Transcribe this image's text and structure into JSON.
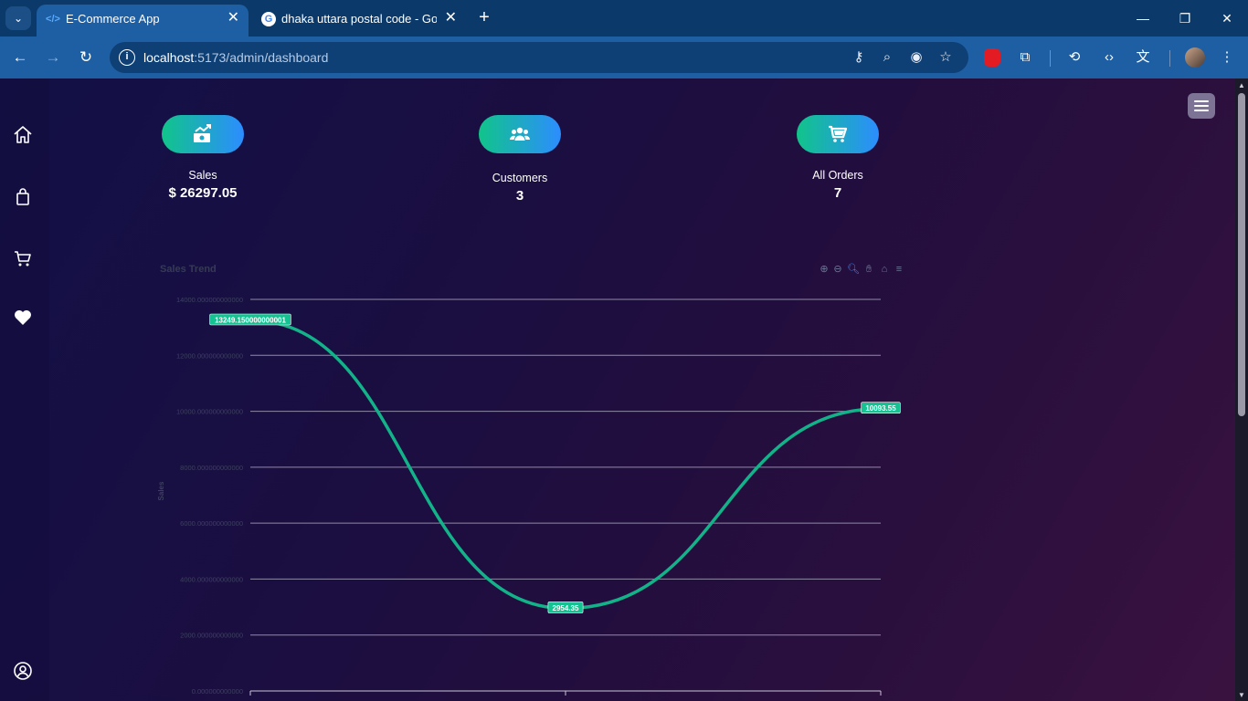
{
  "browser": {
    "tabs": [
      {
        "title": "E-Commerce App",
        "active": true
      },
      {
        "title": "dhaka uttara postal code - Google Search",
        "active": false
      }
    ],
    "url_host": "localhost",
    "url_path": ":5173/admin/dashboard"
  },
  "sidebar": {
    "items": [
      "home-icon",
      "shopping-bag-icon",
      "cart-icon",
      "heart-icon",
      "user-circle-icon"
    ]
  },
  "stats": [
    {
      "label": "Sales",
      "value": "$ 26297.05",
      "icon": "money-trend-icon"
    },
    {
      "label": "Customers",
      "value": "3",
      "icon": "users-icon"
    },
    {
      "label": "All Orders",
      "value": "7",
      "icon": "cart-icon"
    }
  ],
  "colors": {
    "accent_green": "#11c48a",
    "accent_blue": "#2c8dff",
    "line": "#13b38a"
  },
  "chart_data": {
    "type": "line",
    "title": "Sales Trend",
    "ylabel": "Sales",
    "ylim": [
      0,
      14000
    ],
    "yticks": [
      0,
      2000,
      4000,
      6000,
      8000,
      10000,
      12000,
      14000
    ],
    "ytick_labels": [
      "0.000000000000",
      "2000.000000000000",
      "4000.000000000000",
      "6000.000000000000",
      "8000.000000000000",
      "10000.000000000000",
      "12000.000000000000",
      "14000.000000000000"
    ],
    "points": [
      {
        "value": 13249.15,
        "label": "13249.150000000001"
      },
      {
        "value": 2954.35,
        "label": "2954.35"
      },
      {
        "value": 10093.55,
        "label": "10093.55"
      }
    ],
    "curve": "smooth",
    "grid": true
  }
}
